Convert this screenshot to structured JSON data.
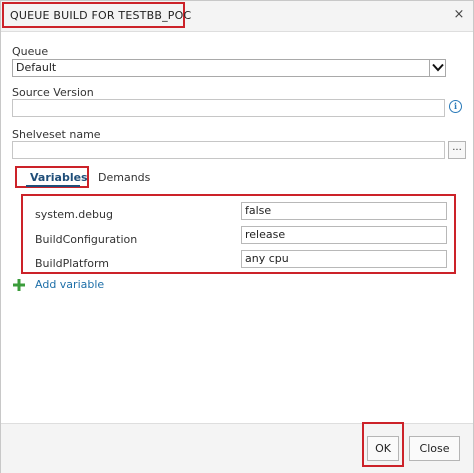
{
  "dialog": {
    "title": "QUEUE BUILD FOR TESTBB_POC",
    "close_icon": "close-icon",
    "close_glyph": "×"
  },
  "form": {
    "queue_label": "Queue",
    "queue_value": "Default",
    "source_version_label": "Source Version",
    "source_version_value": "",
    "shelveset_label": "Shelveset name",
    "shelveset_value": "",
    "ellipsis_label": "...",
    "info_glyph": "i"
  },
  "tabs": [
    {
      "label": "Variables",
      "active": true
    },
    {
      "label": "Demands",
      "active": false
    }
  ],
  "variables": [
    {
      "name": "system.debug",
      "value": "false"
    },
    {
      "name": "BuildConfiguration",
      "value": "release"
    },
    {
      "name": "BuildPlatform",
      "value": "any cpu"
    }
  ],
  "add_variable_label": "Add variable",
  "footer": {
    "ok_label": "OK",
    "close_label": "Close"
  },
  "colors": {
    "highlight": "#cc2229",
    "link": "#1e6fa8",
    "plus": "#3b9c3b",
    "active_tab": "#1f4e79"
  }
}
